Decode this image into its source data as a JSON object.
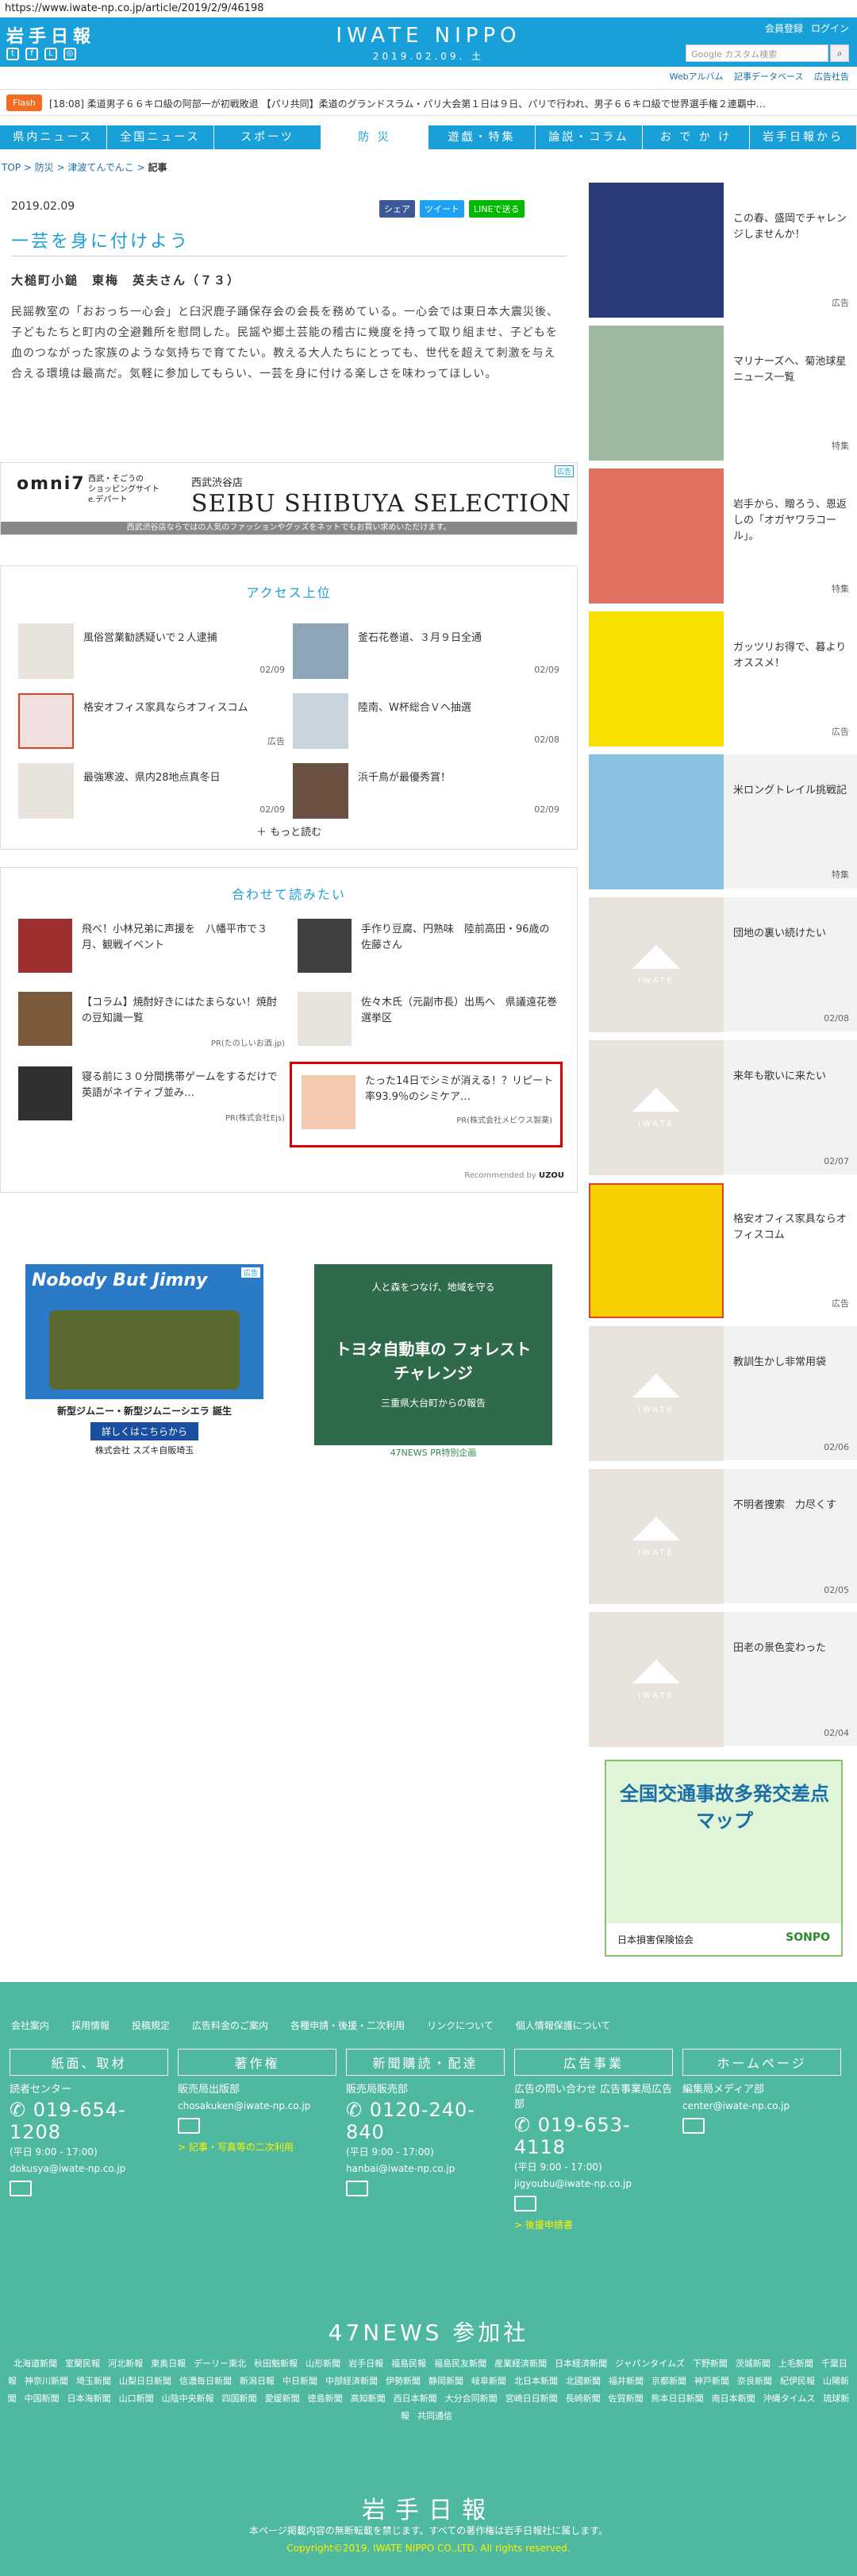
{
  "browser": {
    "url": "https://www.iwate-np.co.jp/article/2019/2/9/46198"
  },
  "header": {
    "logo_jp": "岩手日報",
    "site_name": "IWATE NIPPO",
    "date": "2019.02.09. 土",
    "links": [
      "会員登録",
      "ログイン"
    ],
    "search_placeholder": "Google カスタム検索",
    "sub_links": [
      "Webアルバム",
      "記事データベース",
      "広告社告"
    ]
  },
  "flash": {
    "label": "Flash",
    "text": "[18:08] 柔道男子６６キロ級の阿部一が初戦敗退 【パリ共同】柔道のグランドスラム・パリ大会第１日は９日、パリで行われ、男子６６キロ級で世界選手権２連覇中…"
  },
  "nav": {
    "items": [
      "県内ニュース",
      "全国ニュース",
      "スポーツ",
      "防 災",
      "遊戯・特集",
      "論説・コラム",
      "お で か け",
      "岩手日報から"
    ],
    "active_index": 3
  },
  "breadcrumb": {
    "items": [
      "TOP",
      "防災",
      "津波てんでんこ"
    ],
    "current": "記事"
  },
  "article": {
    "date": "2019.02.09",
    "share": [
      "シェア",
      "ツイート",
      "LINEで送る"
    ],
    "title": "一芸を身に付けよう",
    "byline": "大槌町小鎚　東梅　英夫さん（７３）",
    "body": "民謡教室の「おおっち一心会」と臼沢鹿子踊保存会の会長を務めている。一心会では東日本大震災後、子どもたちと町内の全避難所を慰問した。民謡や郷土芸能の稽古に幾度を持って取り組ませ、子どもを血のつながった家族のような気持ちで育てたい。教える大人たちにとっても、世代を超えて刺激を与え合える環境は最高だ。気軽に参加してもらい、一芸を身に付ける楽しさを味わってほしい。"
  },
  "ad_seibu": {
    "badge": "広告",
    "brand": "omni7",
    "stores": [
      "西武・そごうの",
      "ショッピングサイト",
      "e.デパート"
    ],
    "title": "西武渋谷店",
    "subtitle": "SEIBU SHIBUYA SELECTION",
    "strip": "西武渋谷店ならではの人気のファッションやグッズをネットでもお買い求めいただけます。"
  },
  "ranking": {
    "heading": "アクセス上位",
    "items": [
      {
        "title": "風俗営業勧誘疑いで２人逮捕",
        "date": "02/09"
      },
      {
        "title": "釜石花巻道、３月９日全通",
        "date": "02/09"
      },
      {
        "title": "格安オフィス家具ならオフィスコム",
        "date": "広告"
      },
      {
        "title": "陸南、W杯総合Ｖへ抽選",
        "date": "02/08"
      },
      {
        "title": "最強寒波、県内28地点真冬日",
        "date": "02/09"
      },
      {
        "title": "浜千鳥が最優秀賞！",
        "date": "02/09"
      }
    ],
    "more": "もっと読む"
  },
  "recommend": {
    "heading": "合わせて読みたい",
    "items": [
      {
        "title": "飛べ！小林兄弟に声援を　八幡平市で３月、観戦イベント",
        "pr": ""
      },
      {
        "title": "手作り豆腐、円熟味　陸前高田・96歳の佐藤さん",
        "pr": ""
      },
      {
        "title": "【コラム】焼酎好きにはたまらない！焼酎の豆知識一覧",
        "pr": "PR(たのしいお酒.jp)"
      },
      {
        "title": "佐々木氏（元副市長）出馬へ　県議遠花巻選挙区",
        "pr": ""
      },
      {
        "title": "寝る前に３０分間携帯ゲームをするだけで英語がネイティブ並み…",
        "pr": "PR(株式会社Ejs)"
      },
      {
        "title": "たった14日でシミが消える！？リピート率93.9％のシミケア…",
        "pr": "PR(株式会社メビウス製薬)"
      }
    ],
    "credit": "Recommended by"
  },
  "bigads": [
    {
      "title": "Nobody But Jimny",
      "caption": "新型ジムニー・新型ジムニーシエラ 誕生",
      "cta": "詳しくはこちらから",
      "company": "株式会社 スズキ自販埼玉",
      "badge": "広告"
    },
    {
      "title": "トヨタ自動車の フォレストチャレンジ",
      "caption": "人と森をつなげ、地域を守る",
      "sub": "三重県大台町からの報告",
      "footer": "47NEWS PR特別企画"
    }
  ],
  "sidebar": [
    {
      "text": "この春、盛岡でチャレンジしませんか！",
      "meta": "広告"
    },
    {
      "text": "マリナーズへ、菊池球星ニュース一覧",
      "meta": "特集"
    },
    {
      "text": "岩手から、贈ろう、恩返しの「オガヤワラコール」。",
      "meta": "特集"
    },
    {
      "text": "ガッツリお得で、暮よりオススメ！",
      "meta": "広告"
    },
    {
      "text": "米ロングトレイル挑戦記",
      "meta": "特集"
    },
    {
      "text": "団地の裏い続けたい",
      "meta": "02/08"
    },
    {
      "text": "来年も歌いに来たい",
      "meta": "02/07"
    },
    {
      "text": "格安オフィス家具ならオフィスコム",
      "meta": "広告"
    },
    {
      "text": "教訓生かし非常用袋",
      "meta": "02/06"
    },
    {
      "text": "不明者捜索　力尽くす",
      "meta": "02/05"
    },
    {
      "text": "田老の景色変わった",
      "meta": "02/04"
    }
  ],
  "side_banner": {
    "title": "全国交通事故多発交差点マップ",
    "sub": "日本損害保険協会",
    "brand": "SONPO"
  },
  "footer": {
    "links": [
      "会社案内",
      "採用情報",
      "投稿規定",
      "広告料金のご案内",
      "各種申請・後援・二次利用",
      "リンクについて",
      "個人情報保護について"
    ],
    "boxes": [
      {
        "head": "紙面、取材",
        "sub": "読者センター",
        "phone": "019-654-1208",
        "hours": "(平日 9:00 - 17:00)",
        "mail": "dokusya@iwate-np.co.jp",
        "extra": ""
      },
      {
        "head": "著作権",
        "sub": "販売局出版部",
        "phone": "",
        "hours": "",
        "mail": "chosakuken@iwate-np.co.jp",
        "extra": "> 記事・写真等の二次利用"
      },
      {
        "head": "新聞購読・配達",
        "sub": "販売局販売部",
        "phone": "0120-240-840",
        "hours": "(平日 9:00 - 17:00)",
        "mail": "hanbai@iwate-np.co.jp",
        "extra": ""
      },
      {
        "head": "広告事業",
        "sub": "広告の問い合わせ 広告事業局広告部",
        "phone": "019-653-4118",
        "hours": "(平日 9:00 - 17:00)",
        "mail": "jigyoubu@iwate-np.co.jp",
        "extra": "> 後援申請書"
      },
      {
        "head": "ホームページ",
        "sub": "編集局メディア部",
        "phone": "",
        "hours": "",
        "mail": "center@iwate-np.co.jp",
        "extra": ""
      }
    ],
    "n47_title": "47NEWS 参加社",
    "n47_list": [
      "北海道新聞",
      "室蘭民報",
      "河北新報",
      "東奥日報",
      "デーリー東北",
      "秋田魁新報",
      "山形新聞",
      "岩手日報",
      "福島民報",
      "福島民友新聞",
      "産業経済新聞",
      "日本経済新聞",
      "ジャパンタイムズ",
      "下野新聞",
      "茨城新聞",
      "上毛新聞",
      "千葉日報",
      "神奈川新聞",
      "埼玉新聞",
      "山梨日日新聞",
      "信濃毎日新聞",
      "新潟日報",
      "中日新聞",
      "中部経済新聞",
      "伊勢新聞",
      "静岡新聞",
      "岐阜新聞",
      "北日本新聞",
      "北國新聞",
      "福井新聞",
      "京都新聞",
      "神戸新聞",
      "奈良新聞",
      "紀伊民報",
      "山陽新聞",
      "中国新聞",
      "日本海新聞",
      "山口新聞",
      "山陰中央新報",
      "四国新聞",
      "愛媛新聞",
      "徳島新聞",
      "高知新聞",
      "西日本新聞",
      "大分合同新聞",
      "宮崎日日新聞",
      "長崎新聞",
      "佐賀新聞",
      "熊本日日新聞",
      "南日本新聞",
      "沖縄タイムス",
      "琉球新報",
      "共同通信"
    ],
    "logo": "岩手日報",
    "notice": "本ページ掲載内容の無断転載を禁じます。すべての著作権は岩手日報社に属します。",
    "copyright": "Copyright©2019, IWATE NIPPO CO.,LTD. All rights reserved."
  }
}
